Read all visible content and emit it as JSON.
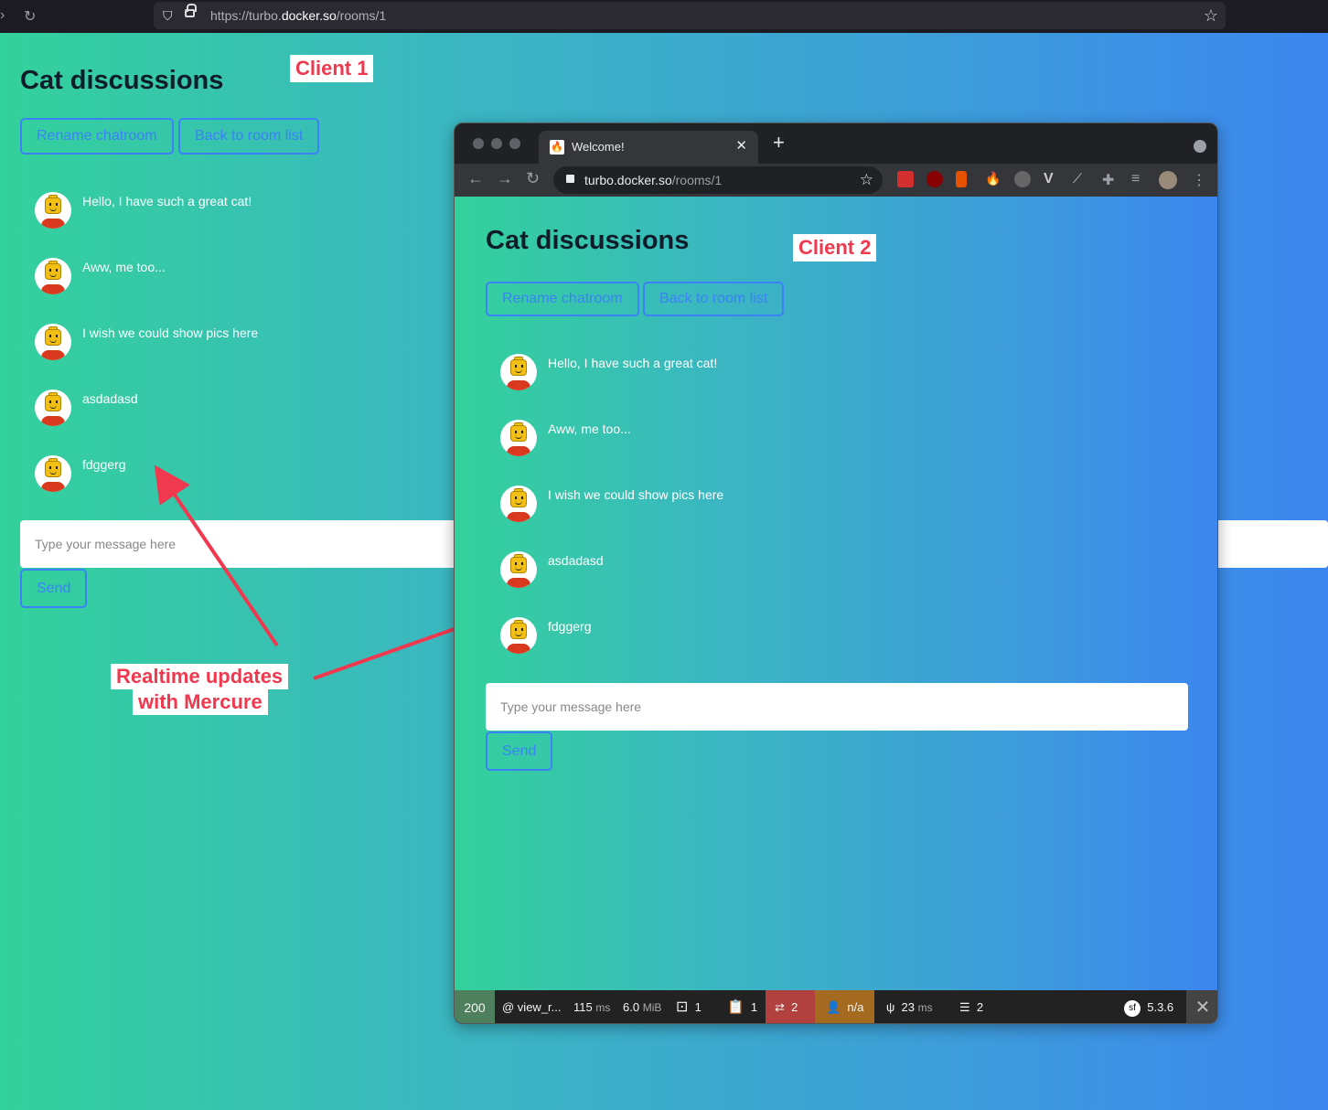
{
  "outer_browser": {
    "url_prefix": "https://turbo.",
    "url_domain": "docker.so",
    "url_path": "/rooms/1"
  },
  "room": {
    "title": "Cat discussions",
    "rename_label": "Rename chatroom",
    "back_label": "Back to room list",
    "messages": [
      {
        "text": "Hello, I have such a great cat!"
      },
      {
        "text": "Aww, me too..."
      },
      {
        "text": "I wish we could show pics here"
      },
      {
        "text": "asdadasd"
      },
      {
        "text": "fdggerg"
      }
    ],
    "input_placeholder": "Type your message here",
    "send_label": "Send"
  },
  "callouts": {
    "client1": "Client 1",
    "client2": "Client 2",
    "realtime_line1": "Realtime updates",
    "realtime_line2": "with Mercure"
  },
  "inner_browser": {
    "tab_title": "Welcome!",
    "url_domain": "turbo.docker.so",
    "url_path": "/rooms/1"
  },
  "debug_toolbar": {
    "status": "200",
    "route": "@ view_r...",
    "time_value": "115",
    "time_unit": "ms",
    "memory_value": "6.0",
    "memory_unit": "MiB",
    "forms_count": "1",
    "logs_count": "1",
    "translation_count": "2",
    "user": "n/a",
    "render_value": "23",
    "render_unit": "ms",
    "db_count": "2",
    "symfony_version": "5.3.6"
  },
  "colors": {
    "accent": "#3b82f6",
    "callout": "#f0384e",
    "gradient_start": "#33d19b",
    "gradient_end": "#3c86ef"
  }
}
